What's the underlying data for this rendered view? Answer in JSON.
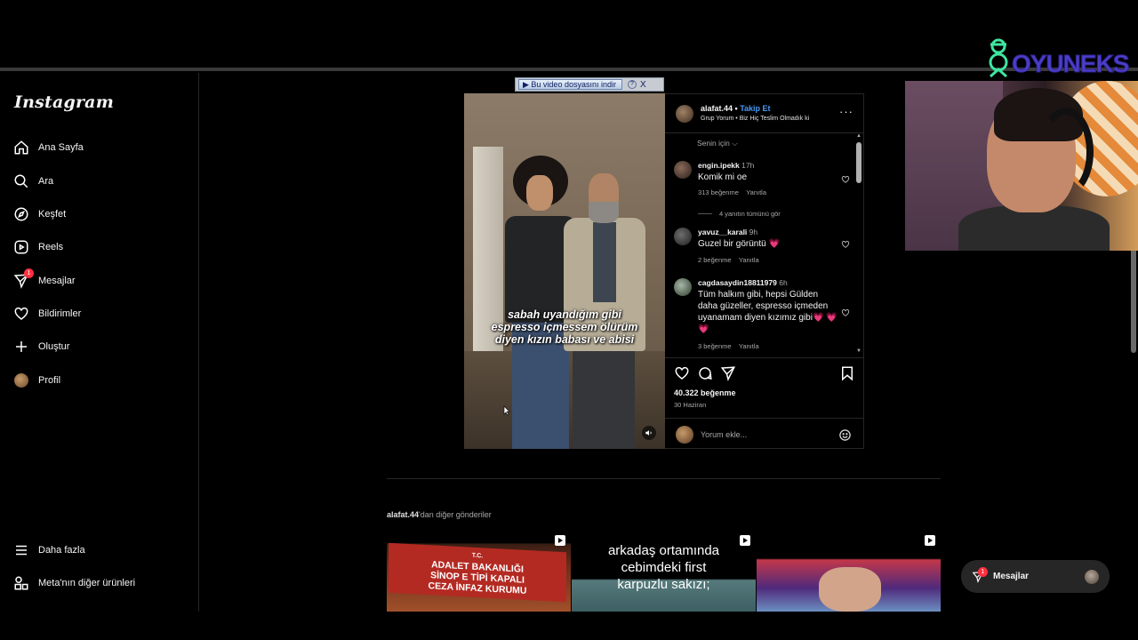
{
  "brand": {
    "overlay_text": "OYUNEKS"
  },
  "sidebar": {
    "logo": "Instagram",
    "items": [
      {
        "label": "Ana Sayfa",
        "icon": "home-icon"
      },
      {
        "label": "Ara",
        "icon": "search-icon"
      },
      {
        "label": "Keşfet",
        "icon": "compass-icon"
      },
      {
        "label": "Reels",
        "icon": "reels-icon"
      },
      {
        "label": "Mesajlar",
        "icon": "messenger-icon",
        "badge": "1"
      },
      {
        "label": "Bildirimler",
        "icon": "heart-icon"
      },
      {
        "label": "Oluştur",
        "icon": "plus-icon"
      },
      {
        "label": "Profil",
        "icon": "avatar"
      }
    ],
    "bottom_items": [
      {
        "label": "Daha fazla",
        "icon": "menu-icon"
      },
      {
        "label": "Meta'nın diğer ürünleri",
        "icon": "meta-products-icon"
      }
    ]
  },
  "download_bar": {
    "label": "▶ Bu video dosyasını indir",
    "help": "?",
    "close": "X"
  },
  "video": {
    "caption_lines": [
      "sabah uyandığım gibi",
      "espresso içmessem ölürüm",
      "diyen kızın babası ve abisi"
    ]
  },
  "post": {
    "username": "alafat.44",
    "separator": "•",
    "follow_label": "Takip Et",
    "audio": "Grup Yorum • Biz Hiç Teslim Olmadık ki",
    "more": "···",
    "sort_label": "Senin için",
    "comments": [
      {
        "user": "engin.ipekk",
        "time": "17h",
        "text": "Komik mi oe",
        "likes": "313 beğenme",
        "reply": "Yanıtla"
      },
      {
        "user": "yavuz__karali",
        "time": "9h",
        "text": "Guzel bir görüntü 💗",
        "likes": "2 beğenme",
        "reply": "Yanıtla"
      },
      {
        "user": "cagdasaydin18811979",
        "time": "6h",
        "text": "Tüm halkım gibi, hepsi Gülden daha güzeller, espresso içmeden uyanamam diyen kızımız gibi💗 💗 💗",
        "likes": "3 beğenme",
        "reply": "Yanıtla"
      }
    ],
    "view_replies": "4 yanıtın tümünü gör",
    "like_count": "40.322 beğenme",
    "date": "30 Haziran",
    "comment_placeholder": "Yorum ekle..."
  },
  "more_posts": {
    "user": "alafat.44",
    "suffix": "'dan diğer gönderiler",
    "thumbs": [
      {
        "lines": [
          "T.C.",
          "ADALET BAKANLIĞI",
          "SİNOP E TİPİ KAPALI",
          "CEZA İNFAZ KURUMU"
        ]
      },
      {
        "lines": [
          "arkadaş ortamında",
          "cebimdeki first",
          "karpuzlu sakızı;"
        ]
      },
      {
        "lines": []
      }
    ]
  },
  "messages_pill": {
    "label": "Mesajlar",
    "badge": "1"
  },
  "colors": {
    "accent": "#4a9bf5",
    "badge": "#ff3040",
    "background": "#000000",
    "border": "#262626"
  }
}
